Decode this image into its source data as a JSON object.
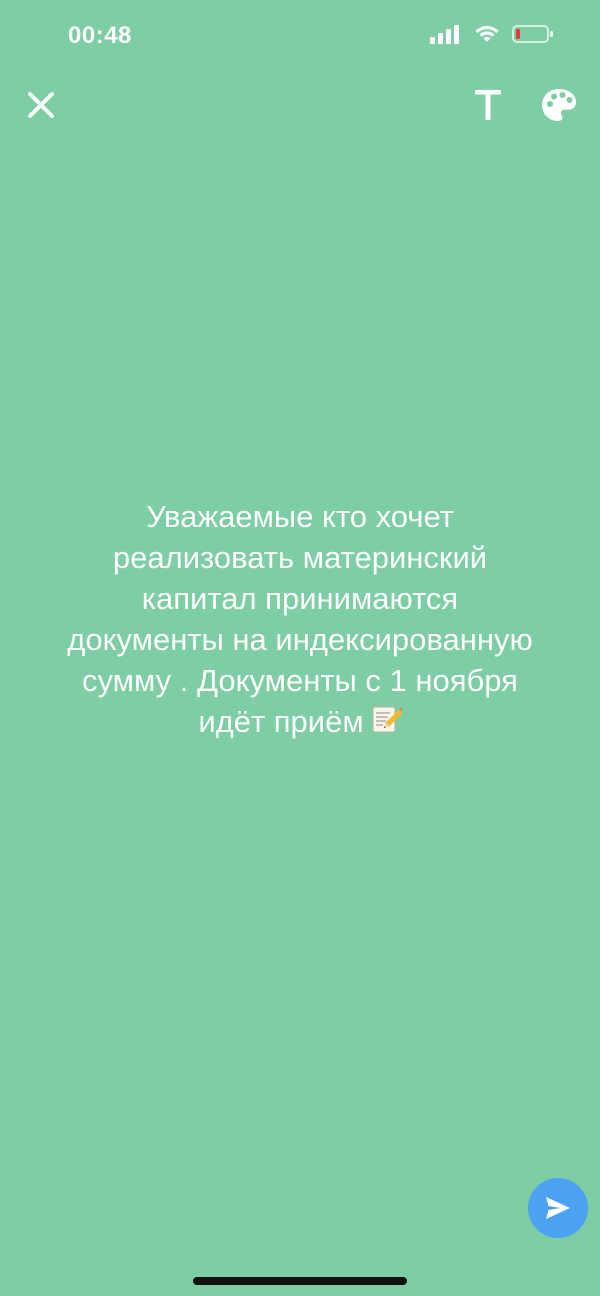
{
  "status_bar": {
    "time": "00:48",
    "icons": [
      "cellular-signal-icon",
      "wifi-icon",
      "battery-low-icon"
    ]
  },
  "toolbar": {
    "close_icon": "close-icon",
    "text_tool_label": "T",
    "palette_icon": "palette-icon"
  },
  "status": {
    "text": "Уважаемые кто хочет реализовать материнский капитал принимаются документы на индексированную сумму . Документы с 1 ноября идёт приём",
    "emoji_icon": "memo-pencil-icon"
  },
  "send_button": {
    "icon": "send-icon"
  },
  "colors": {
    "background": "#7dcda5",
    "send_button": "#4aa2f0",
    "battery_level": "#e23b3b",
    "text": "#ffffff"
  }
}
